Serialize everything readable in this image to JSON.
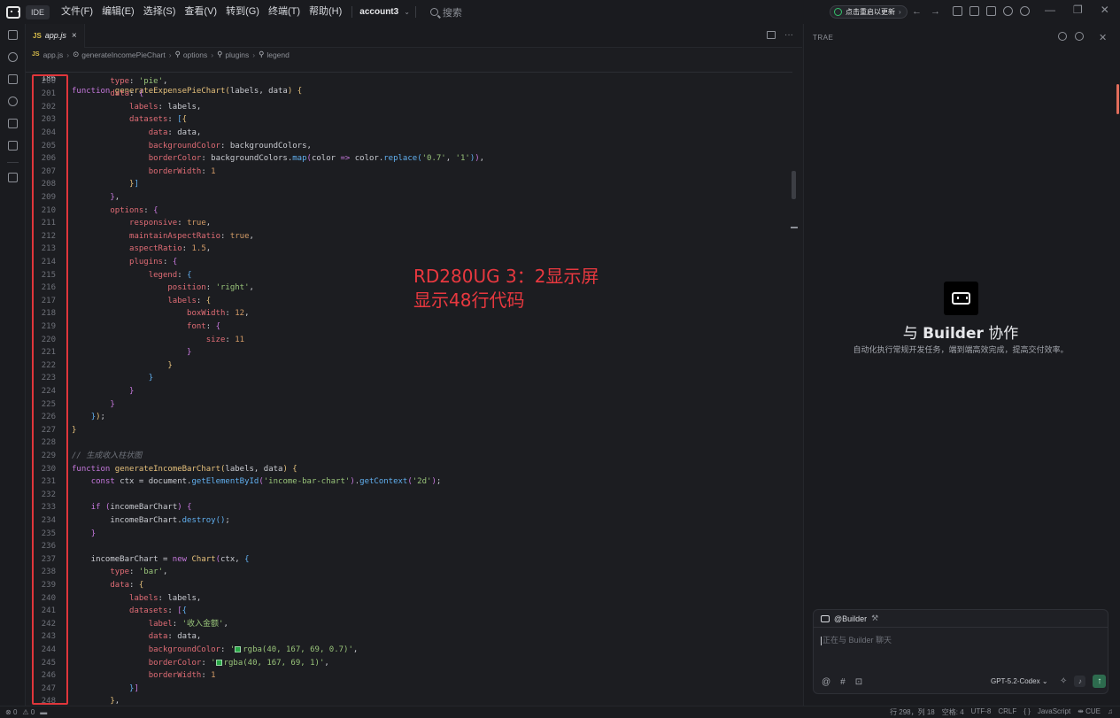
{
  "titlebar": {
    "badge": "IDE",
    "menu": [
      "文件(F)",
      "编辑(E)",
      "选择(S)",
      "查看(V)",
      "转到(G)",
      "终端(T)",
      "帮助(H)"
    ],
    "account": "account3",
    "search_placeholder": "搜索",
    "update_label": "点击重启以更新"
  },
  "editor": {
    "tab": {
      "badge": "JS",
      "name": "app.js",
      "close": "×"
    },
    "breadcrumb": [
      "app.js",
      "generateIncomePieChart",
      "options",
      "plugins",
      "legend"
    ],
    "sticky_line": {
      "num": "186",
      "text": "function generateExpensePieChart(labels, data) {"
    },
    "first_line": 200,
    "last_line": 248
  },
  "annotation": {
    "line1": "RD280UG 3：2显示屏",
    "line2": "显示48行代码",
    "color": "#e8383f"
  },
  "panel": {
    "title": "TRAE",
    "builder_prefix": "与 ",
    "builder_name": "Builder",
    "builder_suffix": " 协作",
    "subtitle": "自动化执行常规开发任务，端到端高效完成，提高交付效率。",
    "chat": {
      "agent": "@Builder",
      "placeholder": "正在与 Builder 聊天",
      "model": "GPT-5.2-Codex"
    }
  },
  "statusbar": {
    "errors": "0",
    "warnings": "0",
    "position": "行 298，列 18",
    "spaces": "空格: 4",
    "encoding": "UTF-8",
    "eol": "CRLF",
    "braces": "{ }",
    "language": "JavaScript",
    "cue": "CUE"
  }
}
